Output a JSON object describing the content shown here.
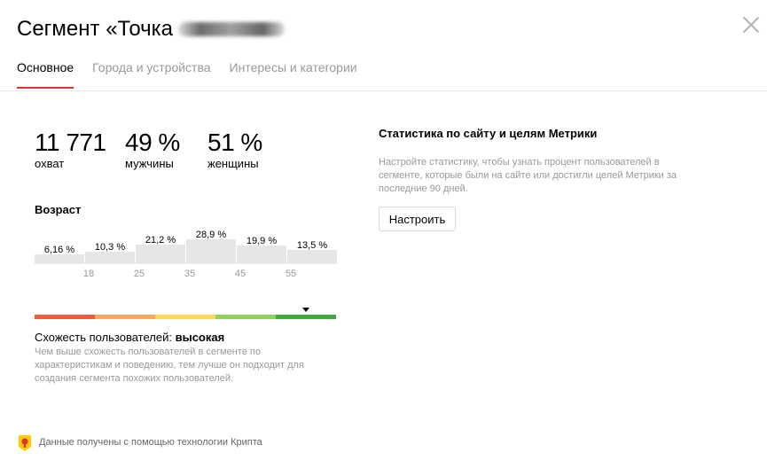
{
  "header": {
    "title": "Сегмент «Точка",
    "close_icon": "close-icon"
  },
  "tabs": [
    {
      "label": "Основное",
      "active": true
    },
    {
      "label": "Города и устройства",
      "active": false
    },
    {
      "label": "Интересы и категории",
      "active": false
    }
  ],
  "metrics": [
    {
      "value": "11 771",
      "label": "охват"
    },
    {
      "value": "49 %",
      "label": "мужчины"
    },
    {
      "value": "51 %",
      "label": "женщины"
    }
  ],
  "age": {
    "title": "Возраст",
    "groups": [
      {
        "label": "6,16 %",
        "value": 6.16
      },
      {
        "label": "10,3 %",
        "value": 10.3
      },
      {
        "label": "21,2 %",
        "value": 21.2
      },
      {
        "label": "28,9 %",
        "value": 28.9
      },
      {
        "label": "19,9 %",
        "value": 19.9
      },
      {
        "label": "13,5 %",
        "value": 13.5
      }
    ],
    "ticks": [
      "18",
      "25",
      "35",
      "45",
      "55"
    ]
  },
  "similarity": {
    "label": "Схожесть пользователей:",
    "value": "высокая",
    "description": "Чем выше схожесть пользователей в сегменте по характеристикам и поведению, тем лучше он подходит для создания сегмента похожих пользователей.",
    "colors": [
      "#f05b3a",
      "#f8a660",
      "#fbd85d",
      "#8ed15c",
      "#3fa83f"
    ],
    "level": 0.9
  },
  "footer": {
    "text": "Данные получены с помощью технологии Крипта",
    "icon": "crypta-logo-icon"
  },
  "right_panel": {
    "title": "Статистика по сайту и целям Метрики",
    "description": "Настройте статистику, чтобы узнать процент пользователей в сегменте, которые были на сайте или достигли целей Метрики за последние 90 дней.",
    "button_label": "Настроить"
  },
  "colors": {
    "accent": "#e5312d",
    "bar": "#e6e6e6",
    "muted_text": "#999999"
  }
}
